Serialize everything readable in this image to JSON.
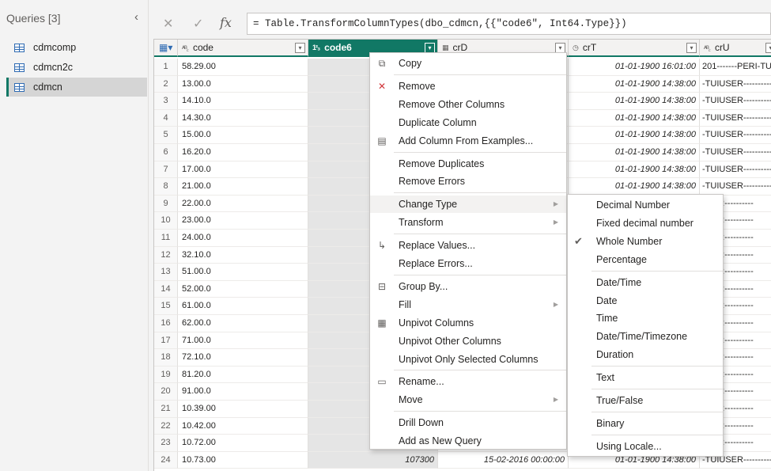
{
  "queries": {
    "header": "Queries [3]",
    "items": [
      {
        "label": "cdmcomp",
        "selected": false
      },
      {
        "label": "cdmcn2c",
        "selected": false
      },
      {
        "label": "cdmcn",
        "selected": true
      }
    ]
  },
  "formula_bar": {
    "cancel": "✕",
    "commit": "✓",
    "fx": "fx",
    "formula": "= Table.TransformColumnTypes(dbo_cdmcn,{{\"code6\", Int64.Type}})"
  },
  "columns": [
    {
      "type_icon": "ABC",
      "label": "code"
    },
    {
      "type_icon": "123",
      "label": "code6"
    },
    {
      "type_icon": "date",
      "label": "crD"
    },
    {
      "type_icon": "time",
      "label": "crT"
    },
    {
      "type_icon": "ABC",
      "label": "crU"
    }
  ],
  "rows": [
    {
      "n": "1",
      "code": "58.29.00",
      "code6": "",
      "crD": "",
      "crT": "01-01-1900 16:01:00",
      "crU": "201-------PERI-TUS"
    },
    {
      "n": "2",
      "code": "13.00.0",
      "code6": "",
      "crD": "",
      "crT": "01-01-1900 14:38:00",
      "crU": "-TUIUSER----------"
    },
    {
      "n": "3",
      "code": "14.10.0",
      "code6": "",
      "crD": "",
      "crT": "01-01-1900 14:38:00",
      "crU": "-TUIUSER----------"
    },
    {
      "n": "4",
      "code": "14.30.0",
      "code6": "",
      "crD": "",
      "crT": "01-01-1900 14:38:00",
      "crU": "-TUIUSER----------"
    },
    {
      "n": "5",
      "code": "15.00.0",
      "code6": "",
      "crD": "",
      "crT": "01-01-1900 14:38:00",
      "crU": "-TUIUSER----------"
    },
    {
      "n": "6",
      "code": "16.20.0",
      "code6": "",
      "crD": "",
      "crT": "01-01-1900 14:38:00",
      "crU": "-TUIUSER----------"
    },
    {
      "n": "7",
      "code": "17.00.0",
      "code6": "",
      "crD": "",
      "crT": "01-01-1900 14:38:00",
      "crU": "-TUIUSER----------"
    },
    {
      "n": "8",
      "code": "21.00.0",
      "code6": "",
      "crD": "",
      "crT": "01-01-1900 14:38:00",
      "crU": "-TUIUSER----------"
    },
    {
      "n": "9",
      "code": "22.00.0",
      "code6": "",
      "crD": "",
      "crT": "",
      "crU": "JSER----------"
    },
    {
      "n": "10",
      "code": "23.00.0",
      "code6": "",
      "crD": "",
      "crT": "",
      "crU": "JSER----------"
    },
    {
      "n": "11",
      "code": "24.00.0",
      "code6": "",
      "crD": "",
      "crT": "",
      "crU": "JSER----------"
    },
    {
      "n": "12",
      "code": "32.10.0",
      "code6": "",
      "crD": "",
      "crT": "",
      "crU": "JSER----------"
    },
    {
      "n": "13",
      "code": "51.00.0",
      "code6": "",
      "crD": "",
      "crT": "",
      "crU": "JSER----------"
    },
    {
      "n": "14",
      "code": "52.00.0",
      "code6": "",
      "crD": "",
      "crT": "",
      "crU": "JSER----------"
    },
    {
      "n": "15",
      "code": "61.00.0",
      "code6": "",
      "crD": "",
      "crT": "",
      "crU": "JSER----------"
    },
    {
      "n": "16",
      "code": "62.00.0",
      "code6": "",
      "crD": "",
      "crT": "",
      "crU": "JSER----------"
    },
    {
      "n": "17",
      "code": "71.00.0",
      "code6": "",
      "crD": "",
      "crT": "",
      "crU": "JSER----------"
    },
    {
      "n": "18",
      "code": "72.10.0",
      "code6": "",
      "crD": "",
      "crT": "",
      "crU": "JSER----------"
    },
    {
      "n": "19",
      "code": "81.20.0",
      "code6": "",
      "crD": "",
      "crT": "",
      "crU": "JSER----------"
    },
    {
      "n": "20",
      "code": "91.00.0",
      "code6": "",
      "crD": "",
      "crT": "",
      "crU": "JSER----------"
    },
    {
      "n": "21",
      "code": "10.39.00",
      "code6": "",
      "crD": "",
      "crT": "",
      "crU": "JSER----------"
    },
    {
      "n": "22",
      "code": "10.42.00",
      "code6": "",
      "crD": "",
      "crT": "",
      "crU": "JSER----------"
    },
    {
      "n": "23",
      "code": "10.72.00",
      "code6": "",
      "crD": "",
      "crT": "",
      "crU": "JSER----------"
    },
    {
      "n": "24",
      "code": "10.73.00",
      "code6": "107300",
      "crD": "15-02-2016 00:00:00",
      "crT": "01-01-1900 14:38:00",
      "crU": "-TUIUSER----------"
    }
  ],
  "context_menu": [
    {
      "label": "Copy",
      "icon": "copy-icon",
      "glyph": "⧉"
    },
    {
      "sep": true
    },
    {
      "label": "Remove",
      "icon": "remove-icon",
      "glyph": "✕"
    },
    {
      "label": "Remove Other Columns"
    },
    {
      "label": "Duplicate Column"
    },
    {
      "label": "Add Column From Examples...",
      "icon": "examples-icon",
      "glyph": "▤"
    },
    {
      "sep": true
    },
    {
      "label": "Remove Duplicates"
    },
    {
      "label": "Remove Errors"
    },
    {
      "sep": true
    },
    {
      "label": "Change Type",
      "submenu": true,
      "highlight": true
    },
    {
      "label": "Transform",
      "submenu": true
    },
    {
      "sep": true
    },
    {
      "label": "Replace Values...",
      "icon": "replace-icon",
      "glyph": "↳"
    },
    {
      "label": "Replace Errors..."
    },
    {
      "sep": true
    },
    {
      "label": "Group By...",
      "icon": "group-icon",
      "glyph": "⊟"
    },
    {
      "label": "Fill",
      "submenu": true
    },
    {
      "label": "Unpivot Columns",
      "icon": "unpivot-icon",
      "glyph": "▦"
    },
    {
      "label": "Unpivot Other Columns"
    },
    {
      "label": "Unpivot Only Selected Columns"
    },
    {
      "sep": true
    },
    {
      "label": "Rename...",
      "icon": "rename-icon",
      "glyph": "▭"
    },
    {
      "label": "Move",
      "submenu": true
    },
    {
      "sep": true
    },
    {
      "label": "Drill Down"
    },
    {
      "label": "Add as New Query"
    }
  ],
  "submenu": [
    {
      "label": "Decimal Number"
    },
    {
      "label": "Fixed decimal number"
    },
    {
      "label": "Whole Number",
      "checked": true
    },
    {
      "label": "Percentage"
    },
    {
      "sep": true
    },
    {
      "label": "Date/Time"
    },
    {
      "label": "Date"
    },
    {
      "label": "Time"
    },
    {
      "label": "Date/Time/Timezone"
    },
    {
      "label": "Duration"
    },
    {
      "sep": true
    },
    {
      "label": "Text"
    },
    {
      "sep": true
    },
    {
      "label": "True/False"
    },
    {
      "sep": true
    },
    {
      "label": "Binary"
    },
    {
      "sep": true
    },
    {
      "label": "Using Locale..."
    }
  ]
}
